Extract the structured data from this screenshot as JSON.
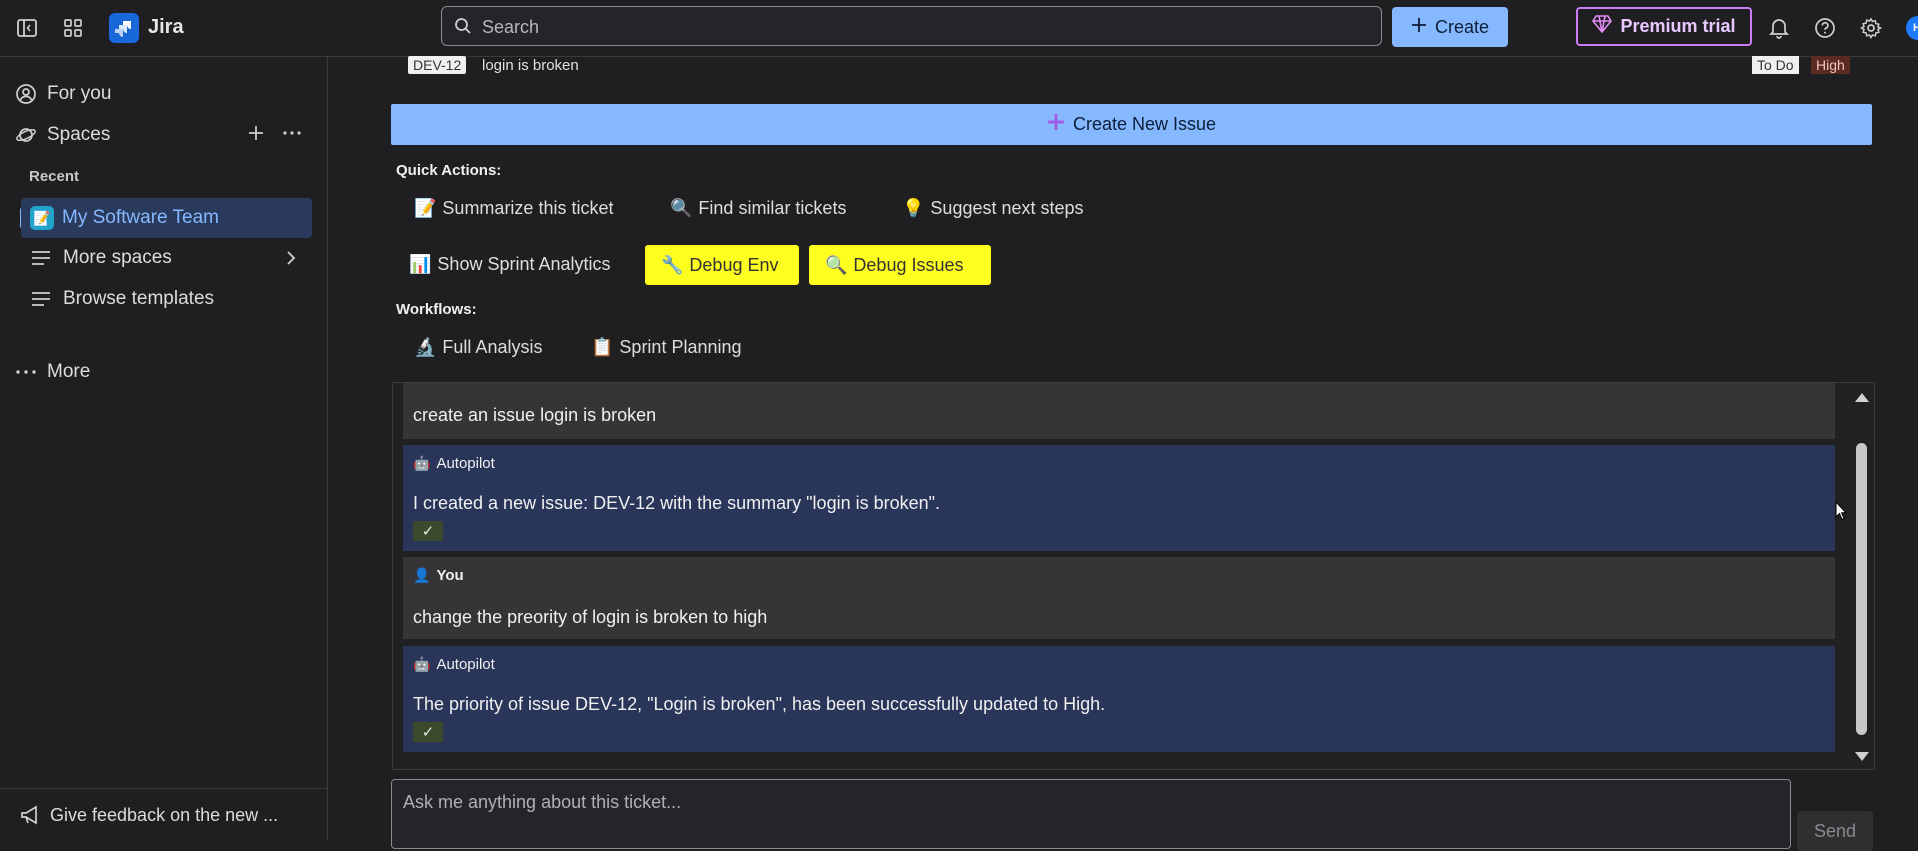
{
  "topbar": {
    "app_name": "Jira",
    "search_placeholder": "Search",
    "create_label": "Create",
    "premium_label": "Premium trial",
    "avatar_initial": "H",
    "icons": [
      "sidebar-toggle-icon",
      "app-switcher-icon",
      "jira-logo-icon",
      "search-icon",
      "plus-icon",
      "diamond-icon",
      "bell-icon",
      "help-icon",
      "gear-icon"
    ]
  },
  "sidebar": {
    "for_you": "For you",
    "spaces": "Spaces",
    "recent": "Recent",
    "team": "My Software Team",
    "more_spaces": "More spaces",
    "browse_templates": "Browse templates",
    "more": "More",
    "feedback": "Give feedback on the new ..."
  },
  "issue": {
    "key": "DEV-12",
    "summary": "login is broken",
    "status": "To Do",
    "priority": "High"
  },
  "main": {
    "create_issue_label": "Create New Issue",
    "quick_actions_title": "Quick Actions:",
    "quick_actions": [
      {
        "icon": "📝",
        "label": "Summarize this ticket"
      },
      {
        "icon": "🔍",
        "label": "Find similar tickets"
      },
      {
        "icon": "💡",
        "label": "Suggest next steps"
      },
      {
        "icon": "📊",
        "label": "Show Sprint Analytics"
      },
      {
        "icon": "🔧",
        "label": "Debug Env"
      },
      {
        "icon": "🔍",
        "label": "Debug Issues"
      }
    ],
    "workflows_title": "Workflows:",
    "workflows": [
      {
        "icon": "🔬",
        "label": "Full Analysis"
      },
      {
        "icon": "📋",
        "label": "Sprint Planning"
      }
    ]
  },
  "chat": {
    "messages": [
      {
        "role": "user",
        "text": "create an issue login is broken"
      },
      {
        "role": "bot",
        "author": "Autopilot",
        "text": "I created a new issue: DEV-12 with the summary \"login is broken\".",
        "check": "✓"
      },
      {
        "role": "user",
        "author": "You",
        "text": "change the preority of login is broken to high"
      },
      {
        "role": "bot",
        "author": "Autopilot",
        "text": "The priority of issue DEV-12, \"Login is broken\", has been successfully updated to High.",
        "check": "✓"
      }
    ],
    "input_placeholder": "Ask me anything about this ticket...",
    "send_label": "Send"
  },
  "colors": {
    "background": "#1f1f21",
    "accent_blue": "#85b8ff",
    "selected_bg": "#2a3a5c",
    "bot_message_bg": "#293559",
    "user_message_bg": "#353537",
    "highlight_yellow": "#ffff1f",
    "premium_border": "#c97cf4",
    "priority_high_bg": "#5a2b22"
  }
}
